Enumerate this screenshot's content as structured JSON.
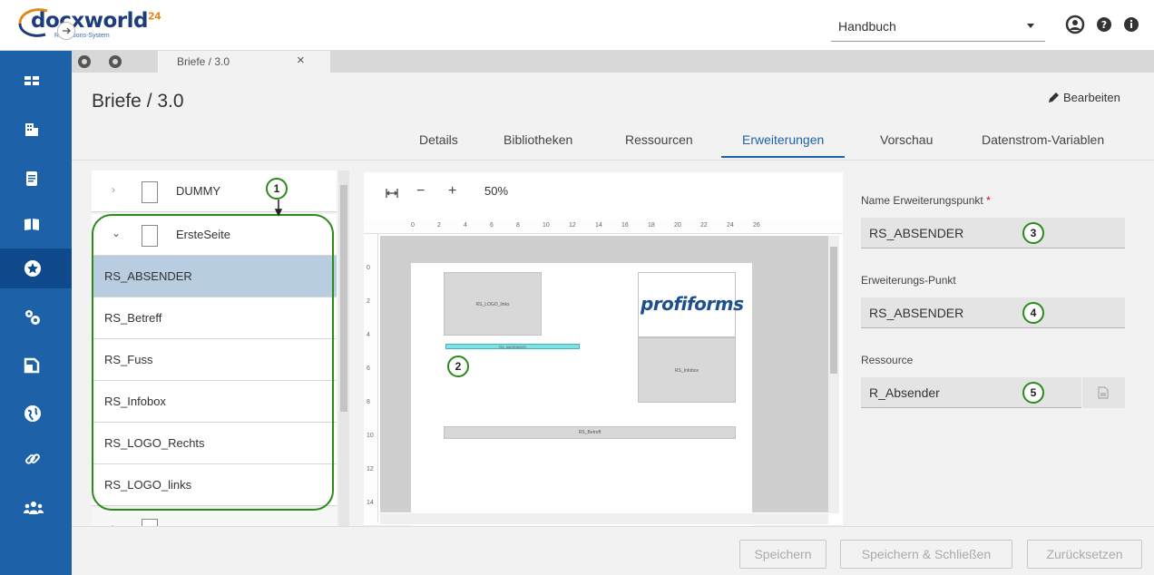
{
  "header": {
    "brand_docx": "docx",
    "brand_world": "world",
    "brand_sup": "24",
    "tagline": "Redaktions-System",
    "manual_select_value": "Handbuch"
  },
  "sidebar": {
    "items": [
      "dashboard",
      "buildings",
      "document",
      "book",
      "star",
      "settings",
      "pages",
      "globe",
      "link",
      "users"
    ],
    "active": "star"
  },
  "tabstrip": {
    "tab_label": "Briefe / 3.0",
    "close_symbol": "×"
  },
  "page": {
    "title": "Briefe / 3.0",
    "edit_label": "Bearbeiten"
  },
  "tabs": [
    {
      "label": "Details"
    },
    {
      "label": "Bibliotheken"
    },
    {
      "label": "Ressourcen"
    },
    {
      "label": "Erweiterungen"
    },
    {
      "label": "Vorschau"
    },
    {
      "label": "Datenstrom-Variablen"
    }
  ],
  "active_tab": "Erweiterungen",
  "tree": {
    "items": [
      {
        "label": "DUMMY"
      },
      {
        "label": "ErsteSeite"
      },
      {
        "label": "RS_ABSENDER"
      },
      {
        "label": "RS_Betreff"
      },
      {
        "label": "RS_Fuss"
      },
      {
        "label": "RS_Infobox"
      },
      {
        "label": "RS_LOGO_Rechts"
      },
      {
        "label": "RS_LOGO_links"
      }
    ],
    "selected": "RS_ABSENDER"
  },
  "callouts": [
    "1",
    "2",
    "3",
    "4",
    "5"
  ],
  "preview": {
    "zoom_label": "50%",
    "zoom_minus": "−",
    "zoom_plus": "+",
    "logo_text": "profiforms",
    "box_logo_links": "RS_LOGO_links",
    "box_absender": "RS_ABSENDER",
    "box_infobox": "RS_Infobox",
    "box_betreff": "RS_Betreff",
    "ruler_h": [
      "0",
      "2",
      "4",
      "6",
      "8",
      "10",
      "12",
      "14",
      "16",
      "18",
      "20",
      "22",
      "24",
      "26"
    ],
    "ruler_v": [
      "0",
      "2",
      "4",
      "6",
      "8",
      "10",
      "12",
      "14"
    ]
  },
  "props": {
    "name_label": "Name Erweiterungspunkt",
    "name_required": "*",
    "name_value": "RS_ABSENDER",
    "point_label": "Erweiterungs-Punkt",
    "point_value": "RS_ABSENDER",
    "resource_label": "Ressource",
    "resource_value": "R_Absender"
  },
  "footer": {
    "save": "Speichern",
    "save_close": "Speichern & Schließen",
    "reset": "Zurücksetzen"
  },
  "colors": {
    "sidebar": "#1d62a8",
    "accent": "#1d62a8",
    "callout_green": "#2a8a1a",
    "selection": "#b9cde0",
    "highlight_cyan": "#7fe3e6"
  }
}
